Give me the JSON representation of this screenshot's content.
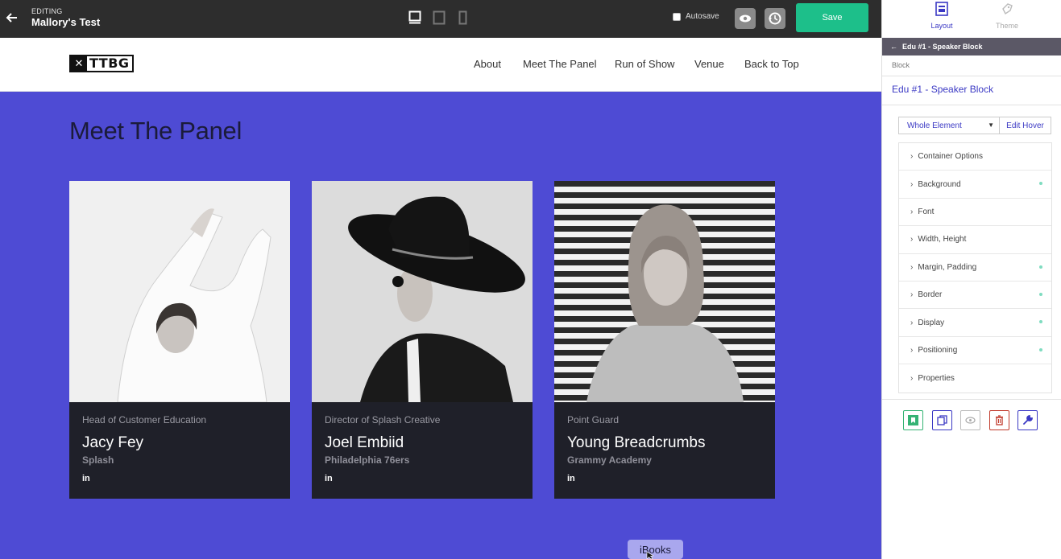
{
  "topbar": {
    "editing_label": "EDITING",
    "page_name": "Mallory's Test",
    "autosave_label": "Autosave",
    "autosave_checked": false,
    "save_label": "Save",
    "devices": [
      "desktop-icon",
      "tablet-icon",
      "mobile-icon"
    ],
    "active_device": "desktop-icon"
  },
  "site": {
    "logo_text": "TTBG",
    "nav": [
      "About",
      "Meet The Panel",
      "Run of Show",
      "Venue",
      "Back to Top"
    ],
    "section_title": "Meet The Panel",
    "speakers": [
      {
        "role": "Head of Customer Education",
        "name": "Jacy Fey",
        "company": "Splash",
        "social": "in"
      },
      {
        "role": "Director of Splash Creative",
        "name": "Joel Embiid",
        "company": "Philadelphia 76ers",
        "social": "in"
      },
      {
        "role": "Point Guard",
        "name": "Young Breadcrumbs",
        "company": "Grammy Academy",
        "social": "in"
      }
    ],
    "section_bg": "#4e4bd4",
    "card_bg": "#1f2029"
  },
  "tooltip": {
    "text": "iBooks"
  },
  "sidepanel": {
    "tabs": [
      {
        "label": "Layout",
        "icon": "layout-icon",
        "active": true
      },
      {
        "label": "Theme",
        "icon": "theme-icon",
        "active": false
      }
    ],
    "breadcrumb": "Edu #1 - Speaker Block",
    "block_label": "Block",
    "block_name": "Edu #1 - Speaker Block",
    "selector_value": "Whole Element",
    "edit_hover_label": "Edit Hover",
    "options": [
      {
        "label": "Container Options",
        "modified": false
      },
      {
        "label": "Background",
        "modified": true
      },
      {
        "label": "Font",
        "modified": false
      },
      {
        "label": "Width, Height",
        "modified": false
      },
      {
        "label": "Margin, Padding",
        "modified": true
      },
      {
        "label": "Border",
        "modified": true
      },
      {
        "label": "Display",
        "modified": true
      },
      {
        "label": "Positioning",
        "modified": true
      },
      {
        "label": "Properties",
        "modified": false
      }
    ],
    "actions": [
      "bookmark-icon",
      "duplicate-icon",
      "visibility-icon",
      "delete-icon",
      "wrench-icon"
    ],
    "accent": "#3b39c4"
  }
}
